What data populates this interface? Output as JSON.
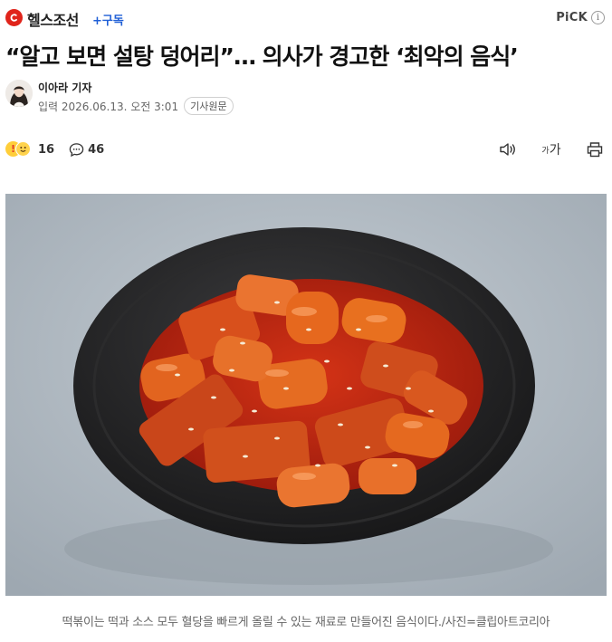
{
  "header": {
    "press_name": "헬스조선",
    "subscribe_label": "+구독",
    "pick_label": "PiCK",
    "info_glyph": "i",
    "brand_color": "#e0241b",
    "link_color": "#1f5fd6"
  },
  "article": {
    "headline": "“알고 보면 설탕 덩어리”… 의사가 경고한 ‘최악의 음식’",
    "reporter": "이아라 기자",
    "date_label": "입력 2026.06.13. 오전 3:01",
    "original_label": "기사원문"
  },
  "toolbar": {
    "reaction_count": "16",
    "comment_count": "46",
    "font_size_small": "가",
    "font_size_large": "가",
    "icons": [
      "audio-icon",
      "font-size-icon",
      "print-icon"
    ]
  },
  "photo": {
    "caption": "떡볶이는 떡과 소스 모두 혈당을 빠르게 올릴 수 있는 재료로 만들어진 음식이다./사진=클립아트코리아"
  }
}
